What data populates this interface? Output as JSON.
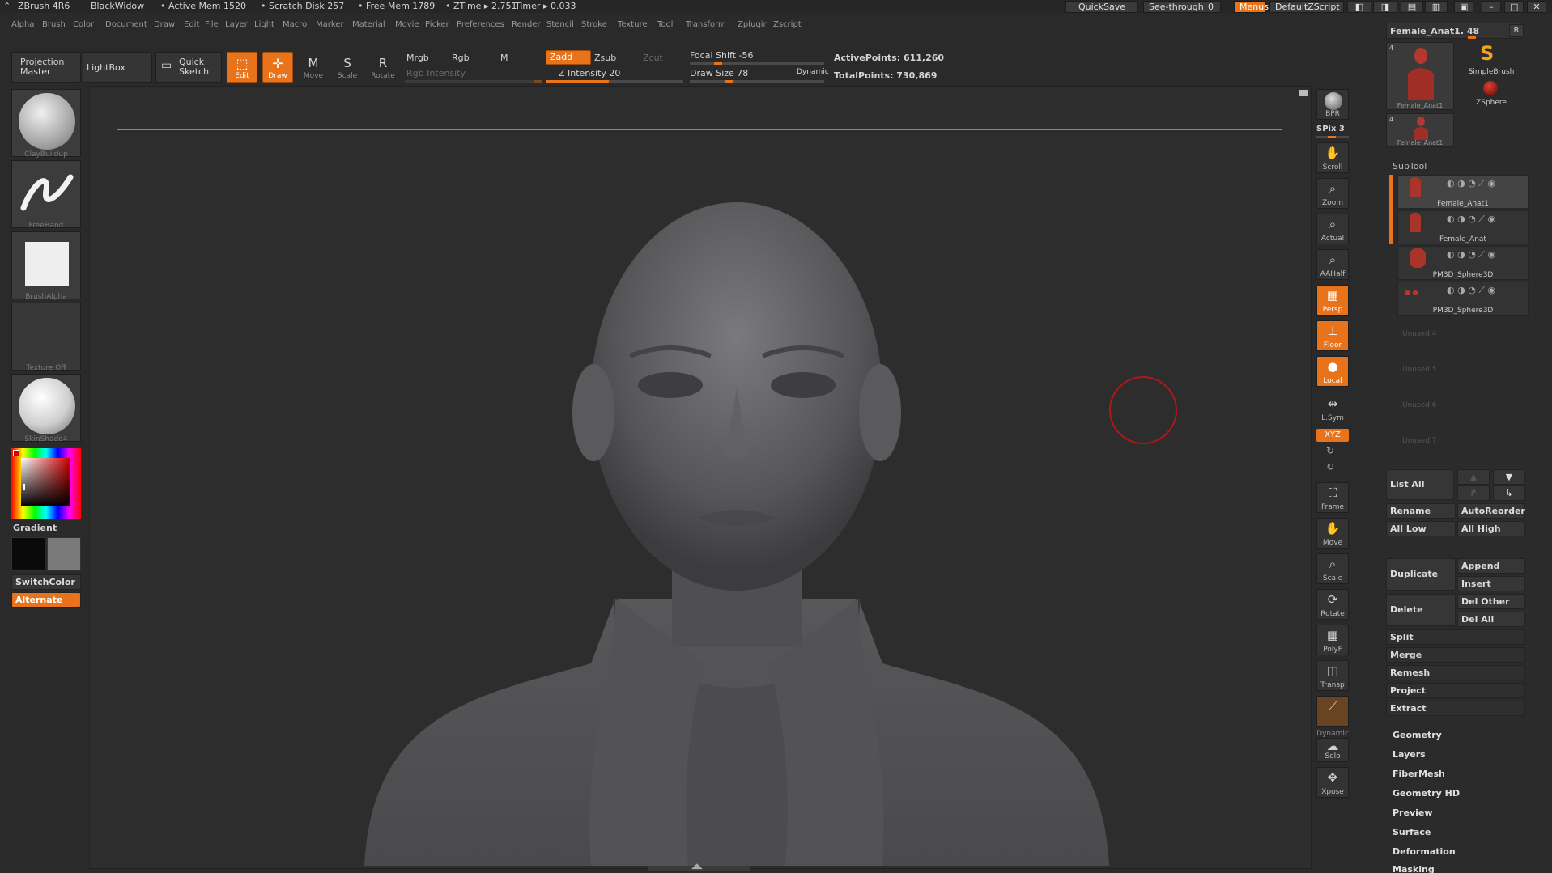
{
  "titlebar": {
    "app": "ZBrush 4R6",
    "theme": "BlackWidow",
    "active_mem": "• Active Mem 1520",
    "scratch_disk": "• Scratch Disk 257",
    "free_mem": "• Free Mem 1789",
    "ztime": "• ZTime ▸ 2.751",
    "timer": "Timer ▸ 0.033",
    "quicksave": "QuickSave",
    "see_through": "See-through",
    "see_through_value": "0",
    "menus": "Menus",
    "default_zscript": "DefaultZScript"
  },
  "menubar": {
    "items": [
      "Alpha",
      "Brush",
      "Color",
      "Document",
      "Draw",
      "Edit",
      "File",
      "Layer",
      "Light",
      "Macro",
      "Marker",
      "Material",
      "Movie",
      "Picker",
      "Preferences",
      "Render",
      "Stencil",
      "Stroke",
      "Texture",
      "Tool",
      "Transform",
      "Zplugin",
      "Zscript"
    ]
  },
  "toolbar": {
    "projection_master": "Projection Master",
    "lightbox": "LightBox",
    "quick_sketch": "Quick Sketch",
    "edit": "Edit",
    "draw": "Draw",
    "move": "Move",
    "scale": "Scale",
    "rotate": "Rotate",
    "mrgb": "Mrgb",
    "rgb": "Rgb",
    "m": "M",
    "rgb_intensity": "Rgb Intensity",
    "zadd": "Zadd",
    "zsub": "Zsub",
    "zcut": "Zcut",
    "z_intensity": "Z Intensity 20",
    "z_intensity_value": 20,
    "focal_shift": "Focal Shift -56",
    "focal_shift_value": -56,
    "draw_size": "Draw Size 78",
    "draw_size_value": 78,
    "dynamic": "Dynamic",
    "active_points": "ActivePoints: 611,260",
    "total_points": "TotalPoints: 730,869"
  },
  "leftpanel": {
    "brush1": "ClayBuildup",
    "brush2": "FreeHand",
    "brush3": "BrushAlpha",
    "brush4": "Texture Off",
    "brush5": "SkinShade4",
    "gradient": "Gradient",
    "switchcolor": "SwitchColor",
    "alternate": "Alternate"
  },
  "righticons": {
    "bpr": "BPR",
    "spix": "SPix 3",
    "scroll": "Scroll",
    "zoom": "Zoom",
    "actual": "Actual",
    "aahalf": "AAHalf",
    "persp": "Persp",
    "floor": "Floor",
    "local": "Local",
    "lsym": "L.Sym",
    "xyz": "XYZ",
    "frame": "Frame",
    "move": "Move",
    "scale": "Scale",
    "rotate": "Rotate",
    "polyf": "PolyF",
    "transp": "Transp",
    "dynamic": "Dynamic",
    "solo": "Solo",
    "xpose": "Xpose"
  },
  "toolpanel": {
    "tool_name": "Female_Anat1. 48",
    "r": "R",
    "thumb1_label": "Female_Anat1",
    "thumb1_count": "4",
    "simplebrush": "SimpleBrush",
    "zsphere": "ZSphere",
    "thumb2_label": "Female_Anat1",
    "thumb2_count": "4"
  },
  "subtool": {
    "header": "SubTool",
    "rows": [
      "Female_Anat1",
      "Female_Anat",
      "PM3D_Sphere3D",
      "PM3D_Sphere3D"
    ],
    "unused": [
      "Unused 4",
      "Unused 5",
      "Unused 6",
      "Unused 7"
    ],
    "list_all": "List All",
    "rename": "Rename",
    "autoreorder": "AutoReorder",
    "all_low": "All Low",
    "all_high": "All High",
    "duplicate": "Duplicate",
    "append": "Append",
    "insert": "Insert",
    "delete": "Delete",
    "del_other": "Del Other",
    "del_all": "Del All",
    "split": "Split",
    "merge": "Merge",
    "remesh": "Remesh",
    "project": "Project",
    "extract": "Extract"
  },
  "palettes": [
    "Geometry",
    "Layers",
    "FiberMesh",
    "Geometry HD",
    "Preview",
    "Surface",
    "Deformation",
    "Masking"
  ],
  "colors": {
    "accent": "#e8731a",
    "background": "#2a2a2a",
    "model": "#5c5c5e"
  }
}
